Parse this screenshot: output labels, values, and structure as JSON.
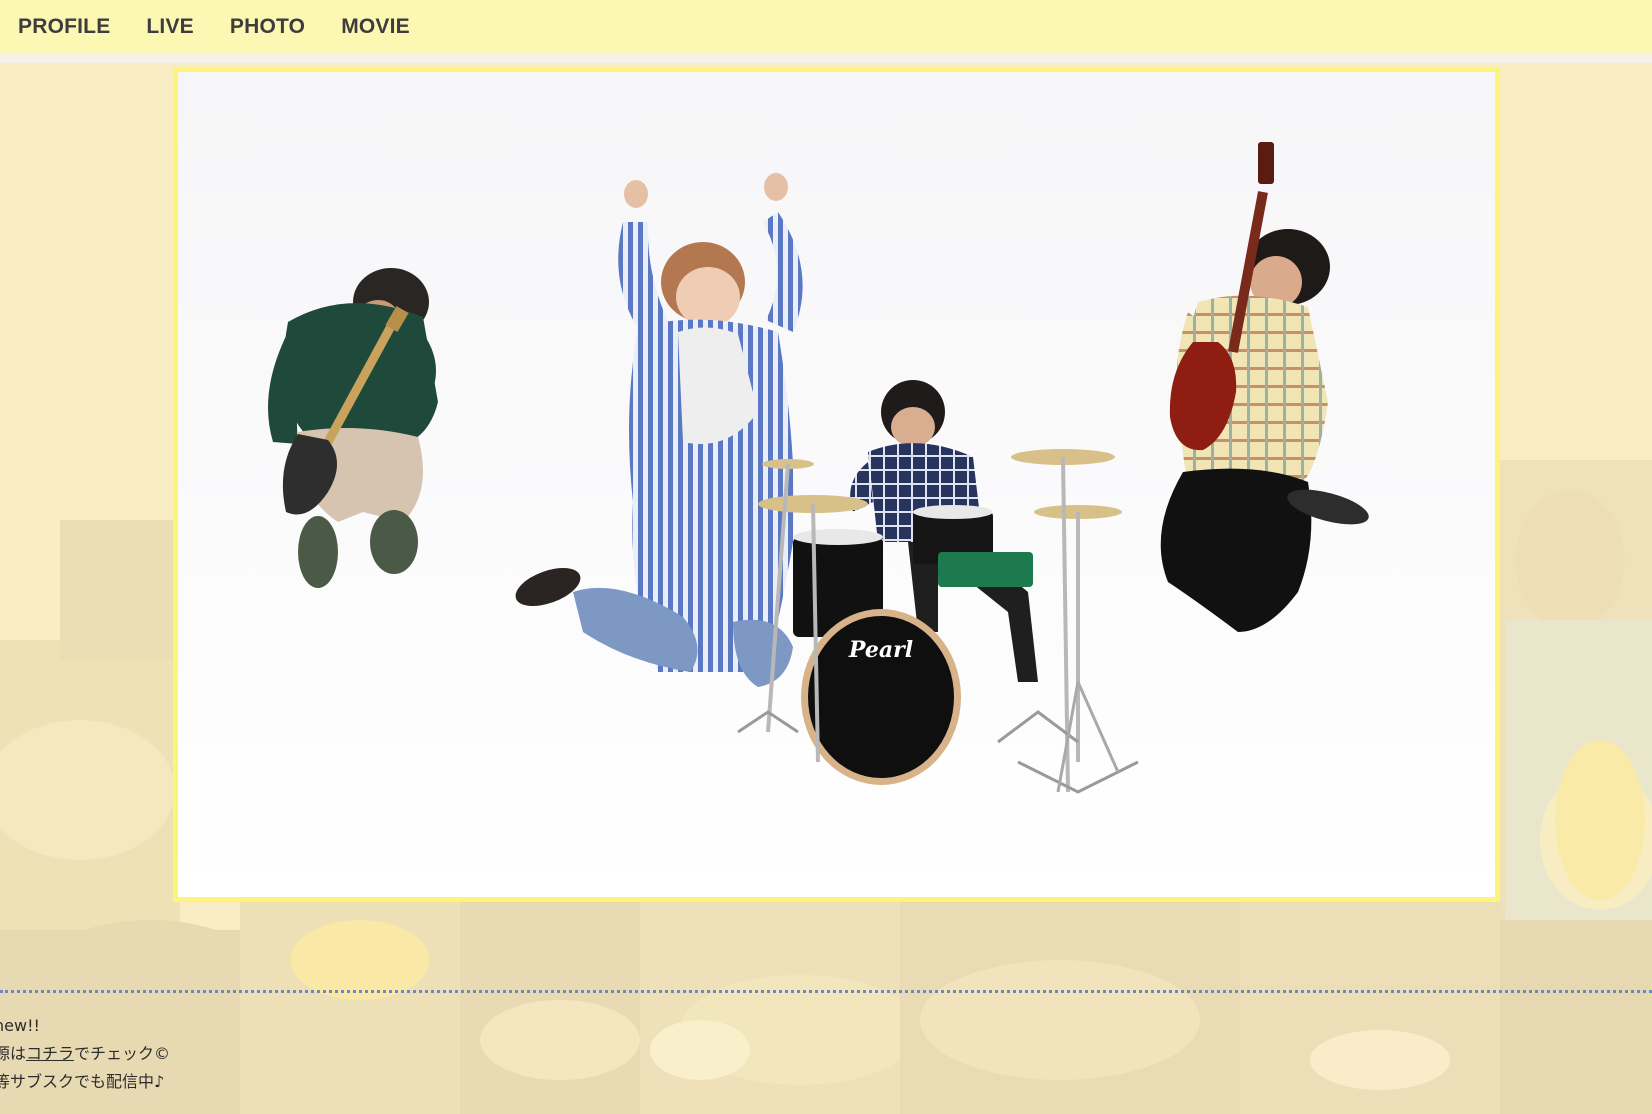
{
  "nav": {
    "items": [
      {
        "label": "PROFILE"
      },
      {
        "label": "LIVE"
      },
      {
        "label": "PHOTO"
      },
      {
        "label": "MOVIE"
      }
    ]
  },
  "hero": {
    "drum_brand": "Pearl"
  },
  "news": {
    "line1": "new!!",
    "line2_prefix": "源は",
    "line2_link": "コチラ",
    "line2_suffix": "でチェック©",
    "line3": "等サブスクでも配信中♪"
  },
  "colors": {
    "nav_bg": "#fdf7b4",
    "hero_border": "#fdf577",
    "divider": "#6d86c9",
    "page_bg": "#f6f0cf"
  }
}
